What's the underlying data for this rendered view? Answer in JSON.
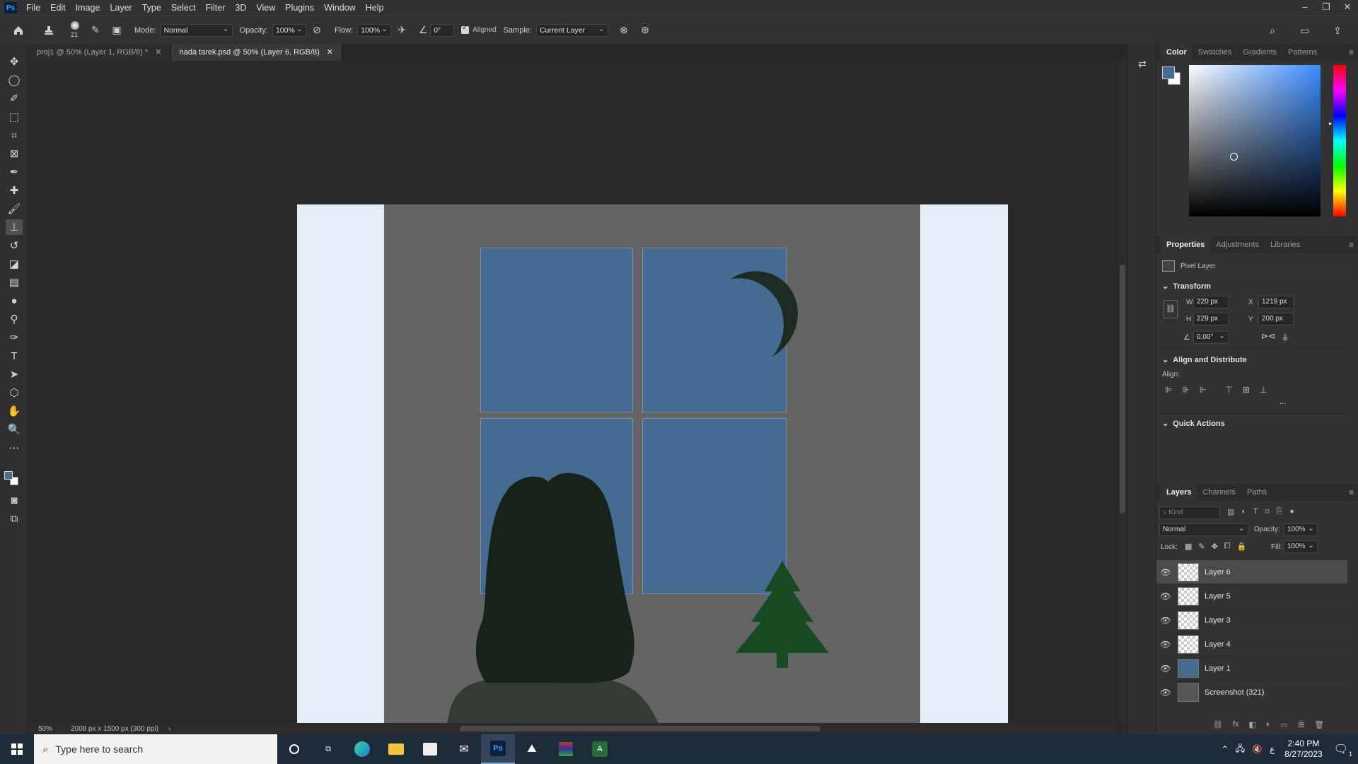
{
  "app": {
    "logo": "Ps"
  },
  "menu": [
    "File",
    "Edit",
    "Image",
    "Layer",
    "Type",
    "Select",
    "Filter",
    "3D",
    "View",
    "Plugins",
    "Window",
    "Help"
  ],
  "window_controls": {
    "minimize": "–",
    "restore": "❐",
    "close": "✕"
  },
  "options": {
    "brush_size": "21",
    "mode_label": "Mode:",
    "mode_value": "Normal",
    "opacity_label": "Opacity:",
    "opacity_value": "100%",
    "flow_label": "Flow:",
    "flow_value": "100%",
    "angle_value": "0°",
    "aligned_label": "Aligned",
    "sample_label": "Sample:",
    "sample_value": "Current Layer"
  },
  "tabs": [
    {
      "label": "proj1 @ 50% (Layer 1, RGB/8) *",
      "active": false
    },
    {
      "label": "nada tarek.psd @ 50% (Layer 6, RGB/8)",
      "active": true
    }
  ],
  "status": {
    "zoom": "50%",
    "doc_info": "2008 px x 1500 px (300 ppi)"
  },
  "color_panel": {
    "tabs": [
      "Color",
      "Swatches",
      "Gradients",
      "Patterns"
    ],
    "active_tab": "Color",
    "foreground": "#446c93",
    "background": "#ffffff"
  },
  "properties_panel": {
    "tabs": [
      "Properties",
      "Adjustments",
      "Libraries"
    ],
    "active_tab": "Properties",
    "kind": "Pixel Layer",
    "transform_title": "Transform",
    "w_label": "W",
    "w_value": "220 px",
    "h_label": "H",
    "h_value": "229 px",
    "x_label": "X",
    "x_value": "1219 px",
    "y_label": "Y",
    "y_value": "200 px",
    "angle_value": "0.00°",
    "align_title": "Align and Distribute",
    "align_label": "Align:",
    "more": "...",
    "quick_actions_title": "Quick Actions"
  },
  "layers_panel": {
    "tabs": [
      "Layers",
      "Channels",
      "Paths"
    ],
    "active_tab": "Layers",
    "filter_placeholder": "Kind",
    "blend_mode": "Normal",
    "opacity_label": "Opacity:",
    "opacity_value": "100%",
    "lock_label": "Lock:",
    "fill_label": "Fill:",
    "fill_value": "100%",
    "layers": [
      {
        "name": "Layer 6",
        "selected": true
      },
      {
        "name": "Layer 5",
        "selected": false
      },
      {
        "name": "Layer 3",
        "selected": false
      },
      {
        "name": "Layer 4",
        "selected": false
      },
      {
        "name": "Layer 1",
        "selected": false
      },
      {
        "name": "Screenshot (321)",
        "selected": false
      }
    ]
  },
  "taskbar": {
    "search_placeholder": "Type here to search",
    "time": "2:40 PM",
    "date": "8/27/2023",
    "notification_count": "1"
  },
  "artwork": {
    "curtain_color": "#e5eef8",
    "wall_color": "#646464",
    "sky_color": "#446c93",
    "moon_color": "#1e2b22",
    "tree_color": "#174a20",
    "hair_color": "#17231a",
    "shirt_color": "#333b33"
  }
}
